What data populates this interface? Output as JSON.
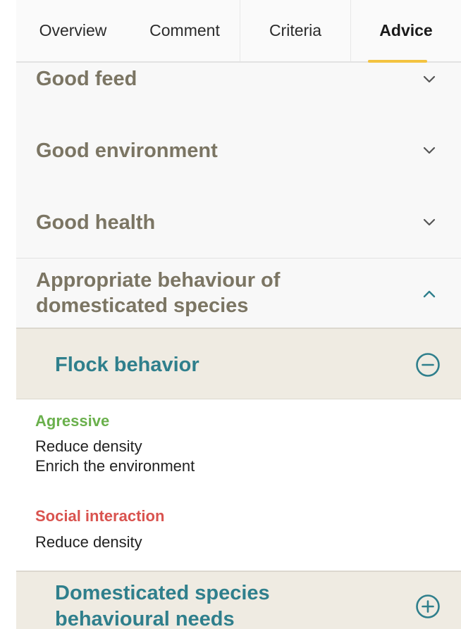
{
  "tabs": [
    {
      "label": "Overview",
      "active": false
    },
    {
      "label": "Comment",
      "active": false
    },
    {
      "label": "Criteria",
      "active": false
    },
    {
      "label": "Advice",
      "active": true
    }
  ],
  "colors": {
    "accent_underline": "#f3c340",
    "section_title": "#7b7563",
    "sub_title": "#2f7f8c",
    "sub_background": "#efebe2",
    "category_green": "#6ab04c",
    "category_red": "#d9534f"
  },
  "sections": [
    {
      "title": "Good feed",
      "expanded": false,
      "icon": "chevron-down-icon"
    },
    {
      "title": "Good environment",
      "expanded": false,
      "icon": "chevron-down-icon"
    },
    {
      "title": "Good health",
      "expanded": false,
      "icon": "chevron-down-icon"
    },
    {
      "title_lines": [
        "Appropriate behaviour of",
        "domesticated species"
      ],
      "expanded": true,
      "icon": "chevron-up-icon"
    }
  ],
  "subsections": [
    {
      "title": "Flock behavior",
      "expanded": true,
      "icon": "minus-circle-icon",
      "advice": [
        {
          "category": "Agressive",
          "items": [
            "Reduce density",
            "Enrich the environment"
          ]
        },
        {
          "category": "Social interaction",
          "items": [
            "Reduce density"
          ]
        }
      ]
    },
    {
      "title_lines": [
        "Domesticated species",
        "behavioural needs"
      ],
      "expanded": false,
      "icon": "plus-circle-icon"
    }
  ]
}
